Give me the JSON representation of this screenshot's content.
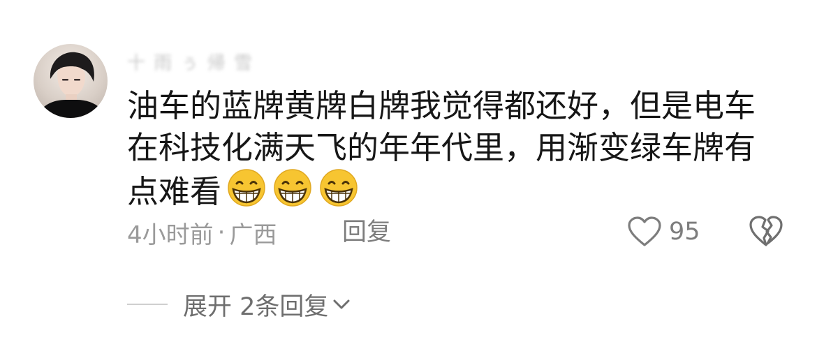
{
  "comment": {
    "username": "十 雨 ぅ 帰 雪",
    "text": "油车的蓝牌黄牌白牌我觉得都还好，但是电车在科技化满天飞的年年代里，用渐变绿车牌有点难看",
    "emojis": [
      "grinning-face-emoji",
      "grinning-face-emoji",
      "grinning-face-emoji"
    ],
    "time": "4小时前",
    "separator": "·",
    "location": "广西",
    "reply_label": "回复",
    "like_count": "95",
    "expand_label": "展开 2条回复"
  },
  "colors": {
    "text_primary": "#161616",
    "text_secondary": "#9a9a9a",
    "action_text": "#7d7d7d",
    "emoji_yellow": "#f7c531"
  },
  "icons": [
    "heart-icon",
    "broken-heart-icon",
    "chevron-down-icon"
  ]
}
